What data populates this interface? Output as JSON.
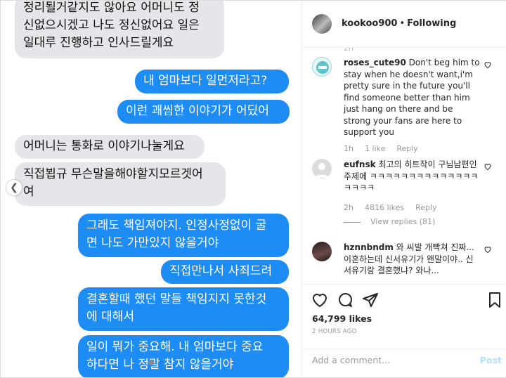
{
  "chat": {
    "messages": [
      {
        "side": "left",
        "text": "정리될거같지도 않아요 어머니도 정\n신없으시겠고 나도 정신없어요 일은\n일대루 진행하고 인사드릴게요"
      },
      {
        "side": "right",
        "text": "내 엄마보다 일먼저라고?"
      },
      {
        "side": "right",
        "text": "이런 괘씸한 이야기가 어딨어"
      },
      {
        "side": "left",
        "text": "어머니는 통화로 이야기나눌게요"
      },
      {
        "side": "left",
        "text": "직접뵙규 무슨말을해야할지모르겟어\n여"
      },
      {
        "side": "right",
        "text": "그래도 책임져야지. 인정사정없이 굴\n면 나도 가만있지 않을거야"
      },
      {
        "side": "right",
        "text": "직접만나서 사죄드려"
      },
      {
        "side": "right",
        "text": "결혼할때 했던 말들 책임지지 못한것\n에 대해서"
      },
      {
        "side": "right",
        "text": "일이 뭐가 중요해. 내 엄마보다 중요\n하다면 나 정말 참지 않을거야"
      }
    ],
    "prev_icon": "chevron-left-icon"
  },
  "header": {
    "username": "kookoo900",
    "separator": "•",
    "follow_label": "Following"
  },
  "comments": {
    "faded_time": "2h",
    "items": [
      {
        "user": "roses_cute90",
        "text": "Don't beg him to stay when he doesn't want,i'm pretty sure in the future you'll find someone better than him just hang on there and be strong your fans are here to support you",
        "time": "1h",
        "likes": "1 like",
        "reply": "Reply"
      },
      {
        "user": "eufnsk",
        "text": "최고의 히트작이 구님남편인주제에 ㅋㅋㅋㅋㅋㅋㅋㅋㅋㅋㅋㅋㅋㅋㅋㅋㅋㅋ",
        "time": "2h",
        "likes": "4816 likes",
        "reply": "Reply",
        "view_replies": "View replies (81)"
      },
      {
        "user": "hznnbndm",
        "text": "와 씨발 개빡쳐 진짜... 이혼하는데 신서유기가 왠말이야.. 신서유기랑 결혼했냐? 와나..."
      }
    ]
  },
  "actions": {
    "likes": "64,799 likes",
    "time_ago": "2 HOURS AGO",
    "icons": [
      "heart-icon",
      "comment-icon",
      "share-icon",
      "bookmark-icon"
    ]
  },
  "add_comment": {
    "placeholder": "Add a comment...",
    "post_label": "Post"
  },
  "colors": {
    "imessage_blue": "#1e8cf5",
    "imessage_gray": "#e5e5ea",
    "post_disabled": "#b2dffc"
  }
}
